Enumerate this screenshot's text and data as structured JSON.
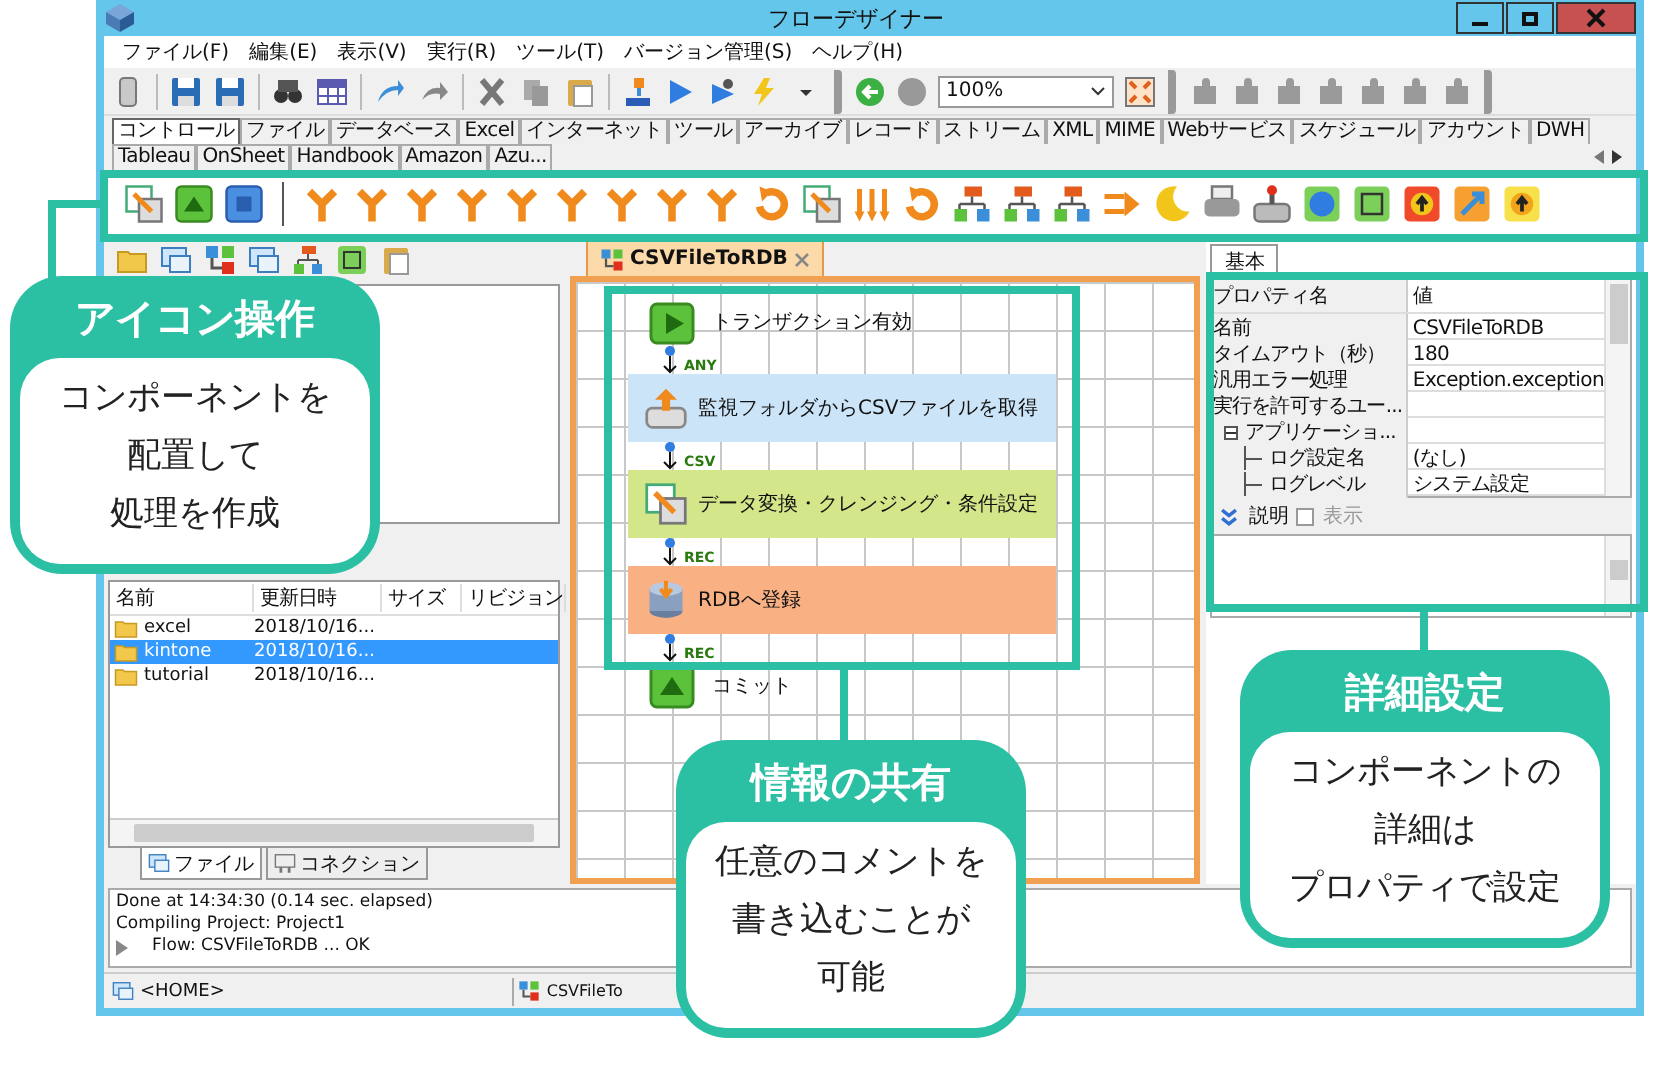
{
  "window": {
    "title": "フローデザイナー"
  },
  "menu": [
    "ファイル(F)",
    "編集(E)",
    "表示(V)",
    "実行(R)",
    "ツール(T)",
    "バージョン管理(S)",
    "ヘルプ(H)"
  ],
  "toolbar": {
    "zoom": "100%"
  },
  "component_tabs": [
    {
      "label": "コントロール",
      "selected": true
    },
    {
      "label": "ファイル",
      "selected": false
    },
    {
      "label": "データベース",
      "selected": false
    },
    {
      "label": "Excel",
      "selected": false
    },
    {
      "label": "インターネット",
      "selected": false
    },
    {
      "label": "ツール",
      "selected": false
    },
    {
      "label": "アーカイブ",
      "selected": false
    },
    {
      "label": "レコード",
      "selected": false
    },
    {
      "label": "ストリーム",
      "selected": false
    },
    {
      "label": "XML",
      "selected": false
    },
    {
      "label": "MIME",
      "selected": false
    },
    {
      "label": "Webサービス",
      "selected": false
    },
    {
      "label": "スケジュール",
      "selected": false
    },
    {
      "label": "アカウント",
      "selected": false
    },
    {
      "label": "DWH",
      "selected": false
    },
    {
      "label": "Tableau",
      "selected": false
    },
    {
      "label": "OnSheet",
      "selected": false
    },
    {
      "label": "Handbook",
      "selected": false
    },
    {
      "label": "Amazon",
      "selected": false
    },
    {
      "label": "Azu...",
      "selected": false
    }
  ],
  "explorer": {
    "columns": [
      "名前",
      "更新日時",
      "サイズ",
      "リビジョン"
    ],
    "rows": [
      {
        "name": "excel",
        "updated": "2018/10/16...",
        "selected": false
      },
      {
        "name": "kintone",
        "updated": "2018/10/16...",
        "selected": true
      },
      {
        "name": "tutorial",
        "updated": "2018/10/16...",
        "selected": false
      }
    ],
    "tabs": [
      {
        "label": "ファイル",
        "selected": true
      },
      {
        "label": "コネクション",
        "selected": false
      }
    ]
  },
  "editor": {
    "tab": "CSVFileToRDB",
    "nodes": [
      {
        "kind": "start",
        "label": "トランザクション有効",
        "port": "ANY"
      },
      {
        "kind": "step",
        "label": "監視フォルダからCSVファイルを取得",
        "port": "CSV",
        "color": "#cce4f7"
      },
      {
        "kind": "step",
        "label": "データ変換・クレンジング・条件設定",
        "port": "REC",
        "color": "#d4e68a"
      },
      {
        "kind": "step",
        "label": "RDBへ登録",
        "port": "REC",
        "color": "#f9b184"
      },
      {
        "kind": "commit",
        "label": "コミット"
      }
    ]
  },
  "properties": {
    "tab": "基本",
    "columns": [
      "プロパティ名",
      "値"
    ],
    "rows": [
      {
        "name": "名前",
        "value": "CSVFileToRDB"
      },
      {
        "name": "タイムアウト（秒）",
        "value": "180"
      },
      {
        "name": "汎用エラー処理",
        "value": "Exception.exception"
      },
      {
        "name": "実行を許可するユー..."
      },
      {
        "name": "アプリケーショ...",
        "expanded": true,
        "children": [
          {
            "name": "ログ設定名",
            "value": "(なし)"
          },
          {
            "name": "ログレベル",
            "value": "システム設定"
          }
        ]
      }
    ],
    "description": {
      "label": "説明",
      "show": {
        "label": "表示",
        "checked": false,
        "disabled": true
      }
    }
  },
  "log": {
    "lines": [
      {
        "kind": "text",
        "text": "Done at 14:34:30 (0.14 sec. elapsed)"
      },
      {
        "kind": "text",
        "text": "Compiling Project: Project1"
      },
      {
        "kind": "flow",
        "text": "Flow: CSVFileToRDB ... OK"
      }
    ]
  },
  "status_bar": {
    "items": [
      "<HOME>",
      "CSVFileTo"
    ]
  },
  "callouts": [
    {
      "title": "アイコン操作",
      "lines": [
        "コンポーネントを",
        "配置して",
        "処理を作成"
      ]
    },
    {
      "title": "情報の共有",
      "lines": [
        "任意のコメントを",
        "書き込むことが",
        "可能"
      ]
    },
    {
      "title": "詳細設定",
      "lines": [
        "コンポーネントの",
        "詳細は",
        "プロパティで設定"
      ]
    }
  ]
}
